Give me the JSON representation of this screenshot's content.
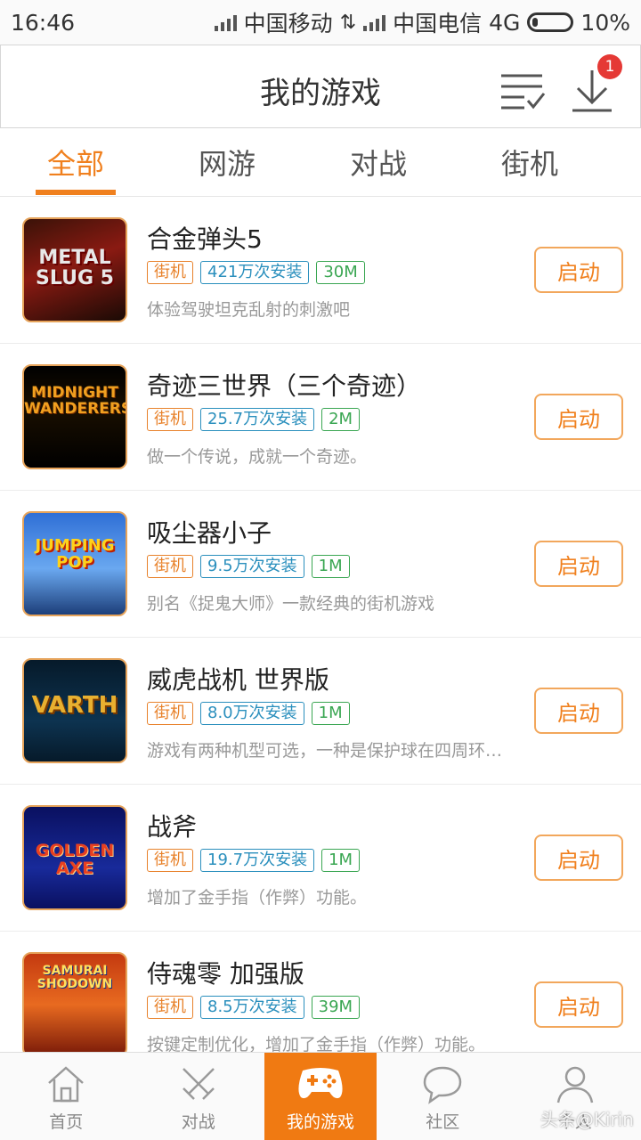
{
  "status_bar": {
    "time": "16:46",
    "carrier1": "中国移动",
    "carrier2": "中国电信",
    "network": "4G",
    "battery": "10%"
  },
  "header": {
    "title": "我的游戏",
    "download_badge": "1"
  },
  "tabs": [
    {
      "label": "全部",
      "active": true
    },
    {
      "label": "网游",
      "active": false
    },
    {
      "label": "对战",
      "active": false
    },
    {
      "label": "街机",
      "active": false
    }
  ],
  "games": [
    {
      "name": "合金弹头5",
      "type": "街机",
      "installs": "421万次安装",
      "size": "30M",
      "desc": "体验驾驶坦克乱射的刺激吧",
      "button": "启动",
      "thumb_text": "METAL SLUG 5"
    },
    {
      "name": "奇迹三世界（三个奇迹）",
      "type": "街机",
      "installs": "25.7万次安装",
      "size": "2M",
      "desc": "做一个传说，成就一个奇迹。",
      "button": "启动",
      "thumb_text": "MIDNIGHT WANDERERS"
    },
    {
      "name": "吸尘器小子",
      "type": "街机",
      "installs": "9.5万次安装",
      "size": "1M",
      "desc": "别名《捉鬼大师》一款经典的街机游戏",
      "button": "启动",
      "thumb_text": "JUMPING POP"
    },
    {
      "name": "威虎战机 世界版",
      "type": "街机",
      "installs": "8.0万次安装",
      "size": "1M",
      "desc": "游戏有两种机型可选，一种是保护球在四周环…",
      "button": "启动",
      "thumb_text": "VARTH"
    },
    {
      "name": "战斧",
      "type": "街机",
      "installs": "19.7万次安装",
      "size": "1M",
      "desc": "增加了金手指（作弊）功能。",
      "button": "启动",
      "thumb_text": "GOLDEN AXE"
    },
    {
      "name": "侍魂零 加强版",
      "type": "街机",
      "installs": "8.5万次安装",
      "size": "39M",
      "desc": "按键定制优化，增加了金手指（作弊）功能。",
      "button": "启动",
      "thumb_text": "SAMURAI SHODOWN"
    }
  ],
  "bottom_nav": [
    {
      "label": "首页",
      "icon": "home-icon",
      "active": false
    },
    {
      "label": "对战",
      "icon": "swords-icon",
      "active": false
    },
    {
      "label": "我的游戏",
      "icon": "gamepad-icon",
      "active": true
    },
    {
      "label": "社区",
      "icon": "chat-bubble-icon",
      "active": false
    },
    {
      "label": "个人",
      "icon": "person-icon",
      "active": false
    }
  ],
  "watermark": "头条@Kirin",
  "colors": {
    "accent": "#f0801e",
    "installs_tag": "#2a8fbd",
    "size_tag": "#3aa652"
  }
}
